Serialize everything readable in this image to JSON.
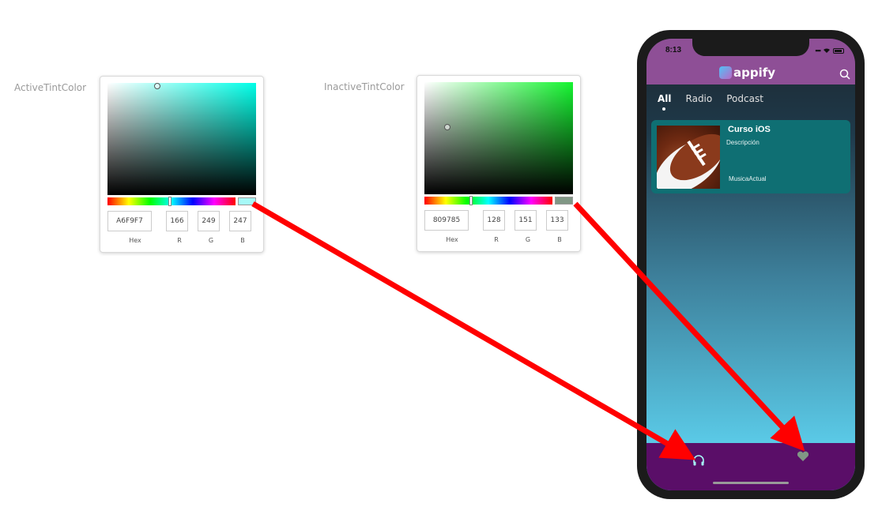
{
  "pickers": [
    {
      "label": "ActiveTintColor",
      "hue_color": "#00FFE8",
      "swatch_color": "#A6F9F7",
      "hex": "A6F9F7",
      "r": "166",
      "g": "249",
      "b": "247",
      "captions": {
        "hex": "Hex",
        "r": "R",
        "g": "G",
        "b": "B"
      }
    },
    {
      "label": "InactiveTintColor",
      "hue_color": "#14F530",
      "swatch_color": "#809785",
      "hex": "809785",
      "r": "128",
      "g": "151",
      "b": "133",
      "captions": {
        "hex": "Hex",
        "r": "R",
        "g": "G",
        "b": "B"
      }
    }
  ],
  "phone": {
    "time": "8:13",
    "status_icons": [
      "signal-icon",
      "wifi-icon",
      "battery-icon"
    ],
    "app_name": "appify",
    "tabs": [
      {
        "label": "All",
        "active": true
      },
      {
        "label": "Radio",
        "active": false
      },
      {
        "label": "Podcast",
        "active": false
      }
    ],
    "card": {
      "title": "Curso iOS",
      "description": "Descripción",
      "subtitle": "MusicaActual",
      "image": "football-image"
    },
    "tab_bar": {
      "items": [
        {
          "icon": "headphones-icon",
          "color": "#A6F9F7"
        },
        {
          "icon": "heart-icon",
          "color": "#809785"
        }
      ]
    }
  },
  "colors": {
    "header_purple": "#8E4F96",
    "tab_bar_purple": "#5A0E68",
    "card_teal": "#0F6F73",
    "arrow_red": "#FF0000"
  }
}
